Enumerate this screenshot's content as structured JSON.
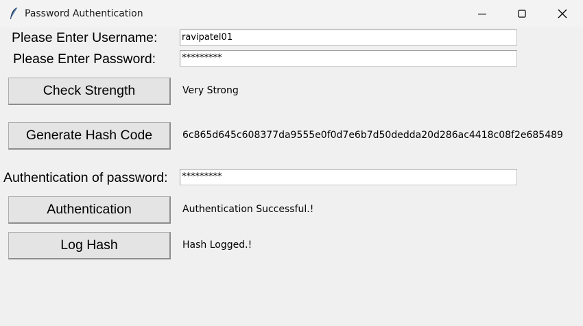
{
  "window": {
    "title": "Password Authentication",
    "icon": "feather-icon",
    "controls": [
      "minimize-icon",
      "maximize-icon",
      "close-icon"
    ]
  },
  "form": {
    "username_label": "Please Enter Username:",
    "username_value": "ravipatel01",
    "password_label": "Please Enter Password:",
    "password_value": "*********",
    "check_strength_button": "Check Strength",
    "strength_result": "Very Strong",
    "generate_hash_button": "Generate Hash Code",
    "hash_result": "6c865d645c608377da9555e0f0d7e6b7d50dedda20d286ac4418c08f2e685489",
    "auth_label": "Authentication of password:",
    "auth_value": "*********",
    "authentication_button": "Authentication",
    "auth_result": "Authentication Successful.!",
    "log_hash_button": "Log Hash",
    "log_result": "Hash Logged.!"
  }
}
